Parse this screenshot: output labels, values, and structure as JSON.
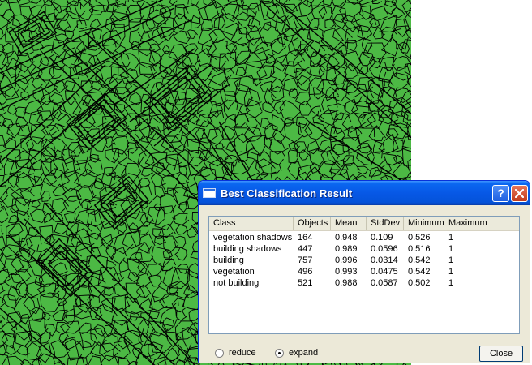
{
  "dialog": {
    "title": "Best Classification Result",
    "help_label": "?",
    "table": {
      "columns": [
        "Class",
        "Objects",
        "Mean",
        "StdDev",
        "Minimum",
        "Maximum"
      ],
      "rows": [
        [
          "vegetation shadows",
          "164",
          "0.948",
          "0.109",
          "0.526",
          "1"
        ],
        [
          "building shadows",
          "447",
          "0.989",
          "0.0596",
          "0.516",
          "1"
        ],
        [
          "building",
          "757",
          "0.996",
          "0.0314",
          "0.542",
          "1"
        ],
        [
          "vegetation",
          "496",
          "0.993",
          "0.0475",
          "0.542",
          "1"
        ],
        [
          "not building",
          "521",
          "0.988",
          "0.0587",
          "0.502",
          "1"
        ]
      ]
    },
    "radio_reduce_label": "reduce",
    "radio_expand_label": "expand",
    "selected_mode": "expand",
    "close_label": "Close"
  },
  "colors": {
    "segment_fill": "#4cb944",
    "segment_outline": "#000000",
    "titlebar": "#0758e6",
    "dialog_face": "#ece9d8"
  }
}
